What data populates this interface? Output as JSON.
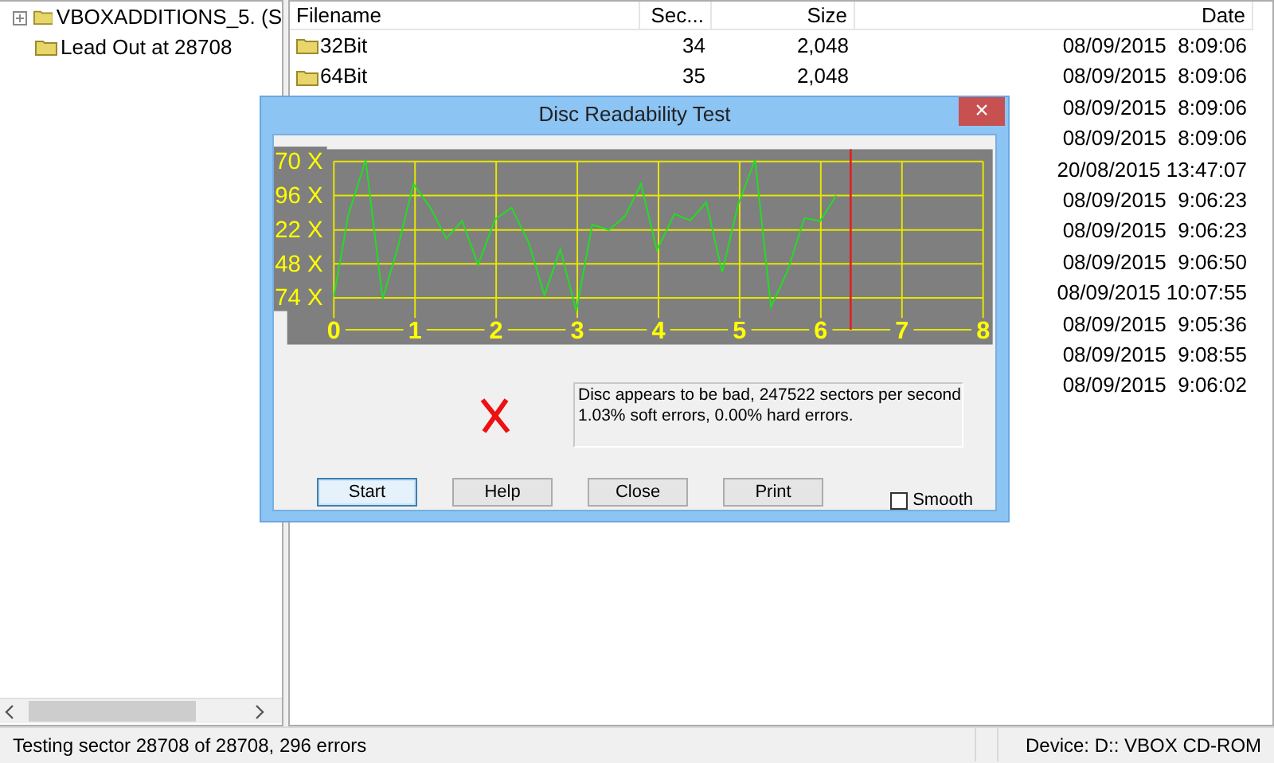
{
  "tree": [
    {
      "label": "VBOXADDITIONS_5. (S",
      "expandable": true
    },
    {
      "label": "Lead Out at 28708",
      "expandable": false
    }
  ],
  "table": {
    "columns": [
      "Filename",
      "Sec...",
      "Size",
      "Date"
    ],
    "rows": [
      {
        "filename": "32Bit",
        "sector": "34",
        "size": "2,048",
        "date": "08/09/2015  8:09:06"
      },
      {
        "filename": "64Bit",
        "sector": "35",
        "size": "2,048",
        "date": "08/09/2015  8:09:06"
      },
      {
        "date": "08/09/2015  8:09:06"
      },
      {
        "date": "08/09/2015  8:09:06"
      },
      {
        "date": "20/08/2015 13:47:07"
      },
      {
        "date": "08/09/2015  9:06:23"
      },
      {
        "date": "08/09/2015  9:06:23"
      },
      {
        "date": "08/09/2015  9:06:50"
      },
      {
        "date": "08/09/2015 10:07:55"
      },
      {
        "date": "08/09/2015  9:05:36"
      },
      {
        "date": "08/09/2015  9:08:55"
      },
      {
        "date": "08/09/2015  9:06:02"
      }
    ]
  },
  "status_bar": {
    "message": "Testing sector 28708 of 28708, 296 errors",
    "device": "Device: D:: VBOX CD-ROM"
  },
  "dialog": {
    "title": "Disc Readability Test",
    "close": "×",
    "graph": {
      "y_labels": [
        "70 X",
        "96 X",
        "22 X",
        "48 X",
        "74 X"
      ],
      "x_labels": [
        "0",
        "1",
        "2",
        "3",
        "4",
        "5",
        "6",
        "7",
        "8"
      ],
      "position": {
        "level": 0.796
      }
    },
    "result": {
      "passed": false,
      "lines": [
        "Disc appears to be bad, 247522 sectors per second",
        "1.03% soft errors, 0.00% hard errors."
      ]
    },
    "buttons": [
      {
        "label": "Start",
        "focused": true
      },
      {
        "label": "Help",
        "focused": false
      },
      {
        "label": "Close",
        "focused": false
      },
      {
        "label": "Print",
        "focused": false
      }
    ],
    "smooth": {
      "label": "Smooth",
      "checked": false
    }
  }
}
